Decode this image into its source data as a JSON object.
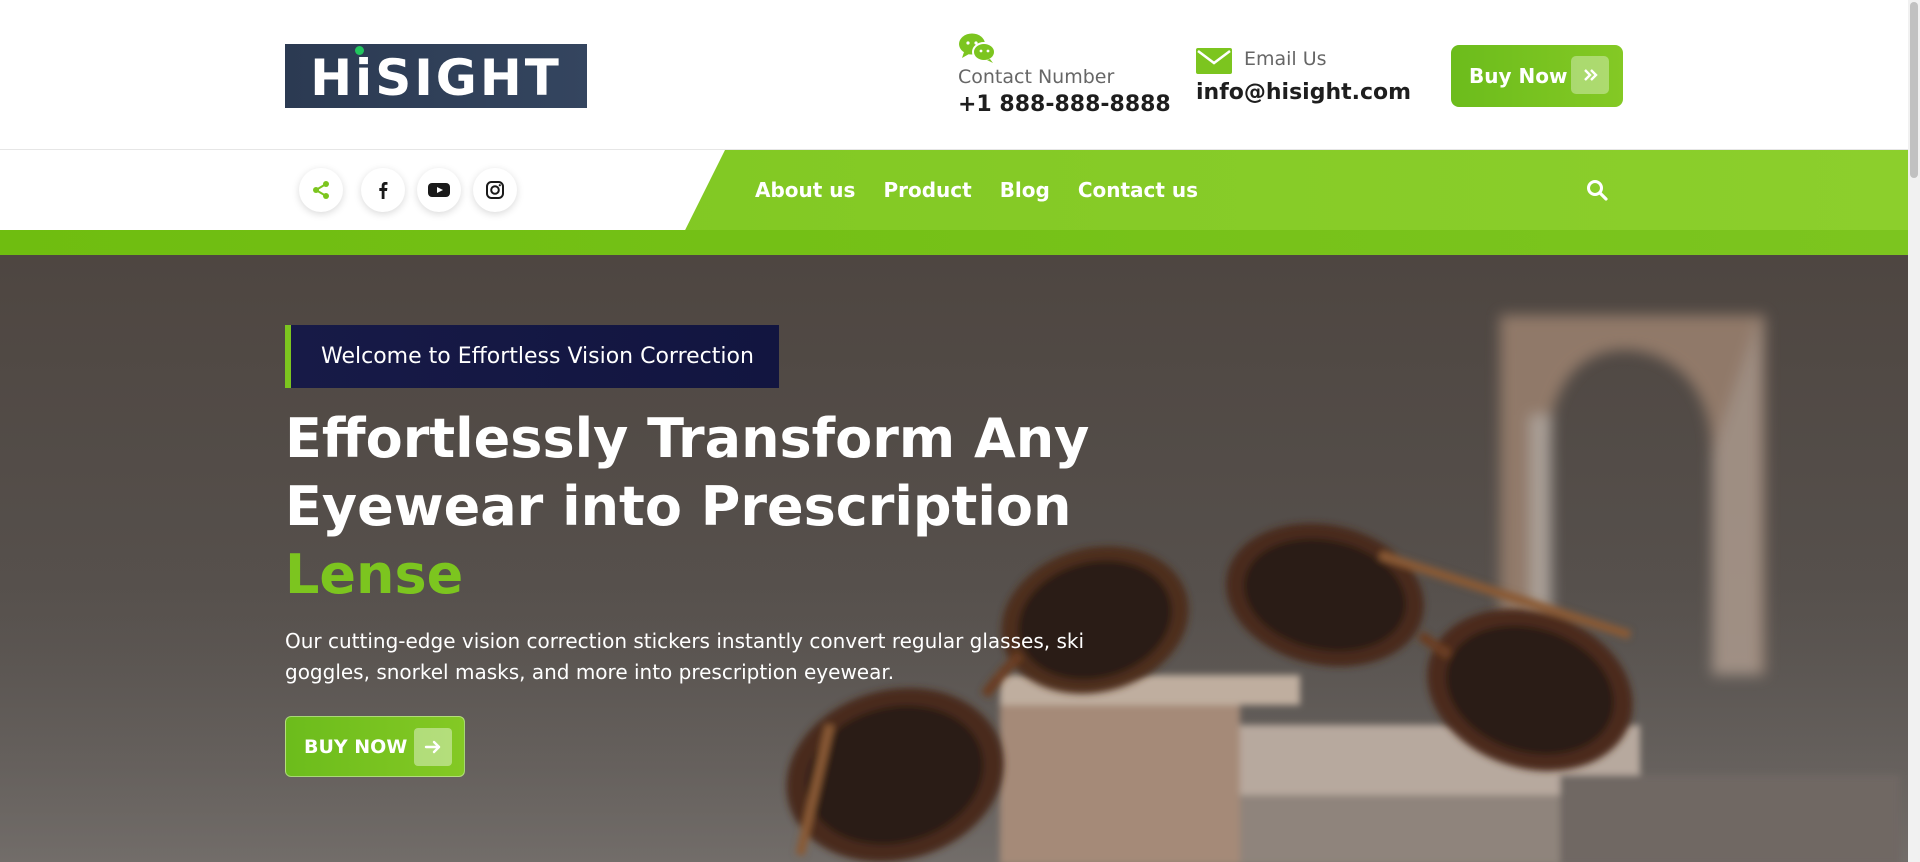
{
  "brand": {
    "logo_text": "HiSIGHT",
    "accent_color": "#7cc51f",
    "navy_color": "#171a47"
  },
  "header": {
    "contact": {
      "label": "Contact Number",
      "value": "+1 888-888-8888",
      "icon": "wechat-icon"
    },
    "email": {
      "label": "Email Us",
      "value": "info@hisight.com",
      "icon": "mail-icon"
    },
    "buy_button": {
      "label": "Buy Now",
      "icon": "double-chevron-right-icon"
    }
  },
  "nav": {
    "social": [
      {
        "name": "share",
        "icon": "share-icon"
      },
      {
        "name": "facebook",
        "icon": "facebook-icon"
      },
      {
        "name": "youtube",
        "icon": "youtube-icon"
      },
      {
        "name": "instagram",
        "icon": "instagram-icon"
      }
    ],
    "links": [
      "About us",
      "Product",
      "Blog",
      "Contact us"
    ],
    "search_icon": "search-icon"
  },
  "hero": {
    "badge": "Welcome to Effortless Vision Correction",
    "headline_line1": "Effortlessly Transform Any",
    "headline_line2": "Eyewear into Prescription",
    "headline_accent": "Lense",
    "subtext": "Our cutting-edge vision correction stickers instantly convert regular glasses, ski goggles, snorkel masks, and more into prescription eyewear.",
    "cta": {
      "label": "BUY NOW",
      "icon": "arrow-right-icon"
    }
  }
}
